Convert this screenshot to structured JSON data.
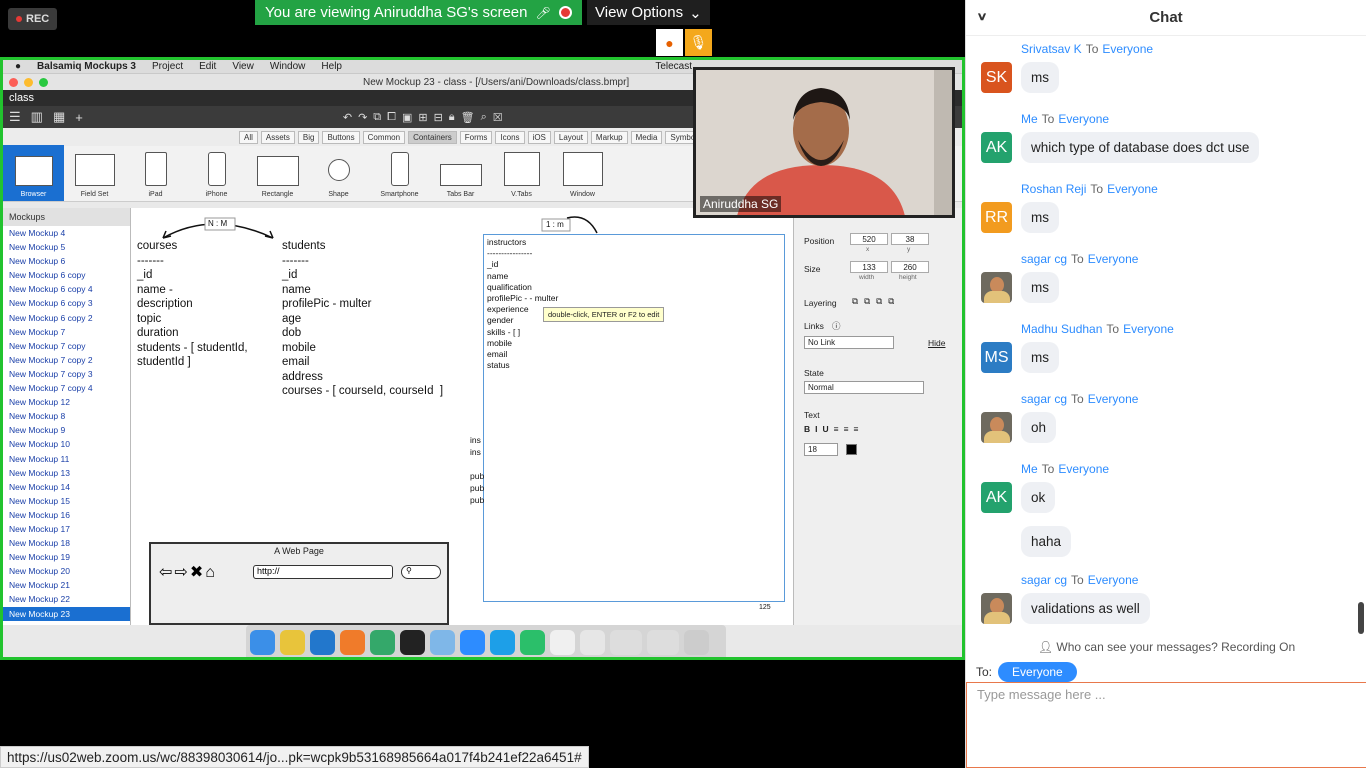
{
  "zoom": {
    "rec_label": "REC",
    "viewing_banner": "You are viewing Aniruddha SG's screen",
    "view_options": "View Options",
    "status_url": "https://us02web.zoom.us/wc/88398030614/jo...pk=wcpk9b53168985664a017f4b241ef22a6451#",
    "camera_name": "Aniruddha SG"
  },
  "balsamiq": {
    "menu": [
      "Balsamiq Mockups 3",
      "Project",
      "Edit",
      "View",
      "Window",
      "Help"
    ],
    "menu_right": "Telecast",
    "window_title": "New Mockup 23 - class - [/Users/ani/Downloads/class.bmpr]",
    "project_tab": "class",
    "component_tabs": [
      "All",
      "Assets",
      "Big",
      "Buttons",
      "Common",
      "Containers",
      "Forms",
      "Icons",
      "iOS",
      "Layout",
      "Markup",
      "Media",
      "Symbols"
    ],
    "selected_tab": "Containers",
    "library": [
      "Browser",
      "Field Set",
      "iPad",
      "iPhone",
      "Rectangle",
      "Shape",
      "Smartphone",
      "Tabs Bar",
      "V.Tabs",
      "Window"
    ],
    "mockups_header": "Mockups",
    "mockups": [
      "New Mockup 4",
      "New Mockup 5",
      "New Mockup 6",
      "New Mockup 6 copy",
      "New Mockup 6 copy 4",
      "New Mockup 6 copy 3",
      "New Mockup 6 copy 2",
      "New Mockup 7",
      "New Mockup 7 copy",
      "New Mockup 7 copy 2",
      "New Mockup 7 copy 3",
      "New Mockup 7 copy 4",
      "New Mockup 12",
      "New Mockup 8",
      "New Mockup 9",
      "New Mockup 10",
      "New Mockup 11",
      "New Mockup 13",
      "New Mockup 14",
      "New Mockup 15",
      "New Mockup 16",
      "New Mockup 17",
      "New Mockup 18",
      "New Mockup 19",
      "New Mockup 20",
      "New Mockup 21",
      "New Mockup 22",
      "New Mockup 23"
    ],
    "canvas": {
      "nm_label": "N : M",
      "onem_label": "1 : m",
      "courses": "courses\n-------\n_id\nname -\ndescription\ntopic\nduration\nstudents - [ studentId,\nstudentId ]",
      "students": "students\n-------\n_id\nname\nprofilePic - multer\nage\ndob\nmobile\nemail\naddress\ncourses - [ courseId, courseId  ]",
      "instructors": "instructors\n----------------\n_id\nname\nqualification\nprofilePic - - multer\nexperience\ngender\nskills - [ ]\nmobile\nemail\nstatus",
      "tooltip": "double-click, ENTER or F2 to edit",
      "partial_left": "ins\nins\n\npub\npub\npub",
      "browser_title": "A Web Page",
      "browser_url": "http://",
      "page_indicator": "125"
    },
    "props": {
      "position_label": "Position",
      "pos_x": "520",
      "pos_y": "38",
      "x_label": "x",
      "y_label": "y",
      "size_label": "Size",
      "width": "133",
      "height": "260",
      "width_label": "width",
      "height_label": "height",
      "layering_label": "Layering",
      "links_label": "Links",
      "link_value": "No Link",
      "hide_label": "Hide",
      "state_label": "State",
      "state_value": "Normal",
      "text_label": "Text",
      "font_size": "18"
    }
  },
  "chat": {
    "title": "Chat",
    "to_word": "To",
    "messages": [
      {
        "sender": "Srivatsav K",
        "to": "Everyone",
        "initials": "SK",
        "color": "#d9541e",
        "text": "ms"
      },
      {
        "sender": "Me",
        "to": "Everyone",
        "initials": "AK",
        "color": "#23a26d",
        "text": "which type of database does dct use"
      },
      {
        "sender": "Roshan Reji",
        "to": "Everyone",
        "initials": "RR",
        "color": "#f29b1f",
        "text": "ms"
      },
      {
        "sender": "sagar cg",
        "to": "Everyone",
        "initials": "",
        "color": "",
        "text": "ms"
      },
      {
        "sender": "Madhu Sudhan",
        "to": "Everyone",
        "initials": "MS",
        "color": "#2c7cc4",
        "text": "ms"
      },
      {
        "sender": "sagar cg",
        "to": "Everyone",
        "initials": "",
        "color": "",
        "text": "oh"
      },
      {
        "sender": "Me",
        "to": "Everyone",
        "initials": "AK",
        "color": "#23a26d",
        "text": "ok"
      },
      {
        "sender": "",
        "to": "",
        "initials": "",
        "color": "",
        "text": "haha"
      },
      {
        "sender": "sagar cg",
        "to": "Everyone",
        "initials": "",
        "color": "",
        "text": "validations as well"
      }
    ],
    "who_can_see": "Who can see your messages? Recording On",
    "to_label": "To:",
    "to_value": "Everyone",
    "input_placeholder": "Type message here ..."
  }
}
